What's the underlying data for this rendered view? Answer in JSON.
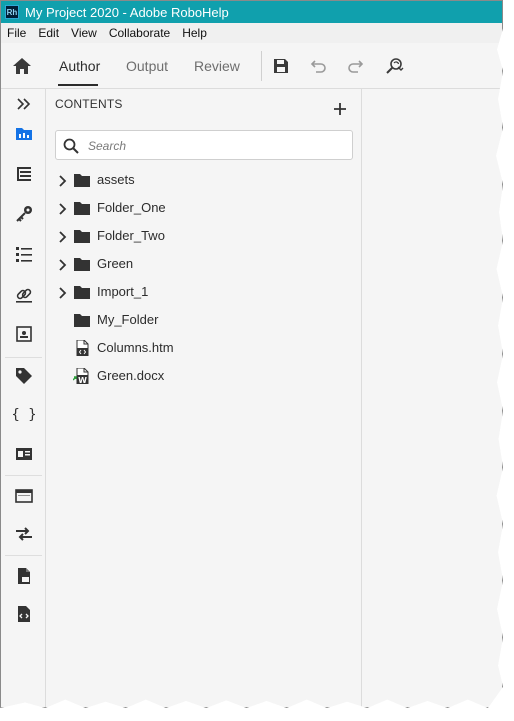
{
  "window": {
    "title": "My Project 2020 - Adobe RoboHelp",
    "app_icon_text": "Rh"
  },
  "menu": [
    "File",
    "Edit",
    "View",
    "Collaborate",
    "Help"
  ],
  "toolbar": {
    "tabs": [
      {
        "label": "Author",
        "active": true
      },
      {
        "label": "Output",
        "active": false
      },
      {
        "label": "Review",
        "active": false
      }
    ],
    "icons": [
      "home-icon",
      "save-icon",
      "undo-icon",
      "redo-icon",
      "search-replace-icon"
    ]
  },
  "left_rail": {
    "icons": [
      "expand-icon",
      "contents-icon",
      "toc-icon",
      "key-icon",
      "list-icon",
      "link-icon",
      "snippet-icon",
      "tag-icon",
      "variables-icon",
      "id-card-icon",
      "window-icon",
      "swap-icon",
      "file-export-icon",
      "file-code-icon"
    ],
    "active": "contents-icon"
  },
  "contents": {
    "title": "CONTENTS",
    "search_placeholder": "Search",
    "items": [
      {
        "label": "assets",
        "type": "folder",
        "expandable": true
      },
      {
        "label": "Folder_One",
        "type": "folder",
        "expandable": true
      },
      {
        "label": "Folder_Two",
        "type": "folder",
        "expandable": true
      },
      {
        "label": "Green",
        "type": "folder",
        "expandable": true
      },
      {
        "label": "Import_1",
        "type": "folder",
        "expandable": true
      },
      {
        "label": "My_Folder",
        "type": "folder",
        "expandable": false
      },
      {
        "label": "Columns.htm",
        "type": "htm-file",
        "expandable": false
      },
      {
        "label": "Green.docx",
        "type": "docx-file",
        "expandable": false
      }
    ]
  },
  "colors": {
    "titlebar": "#10a0ad",
    "accent": "#1473e6",
    "background": "#f5f5f5"
  }
}
